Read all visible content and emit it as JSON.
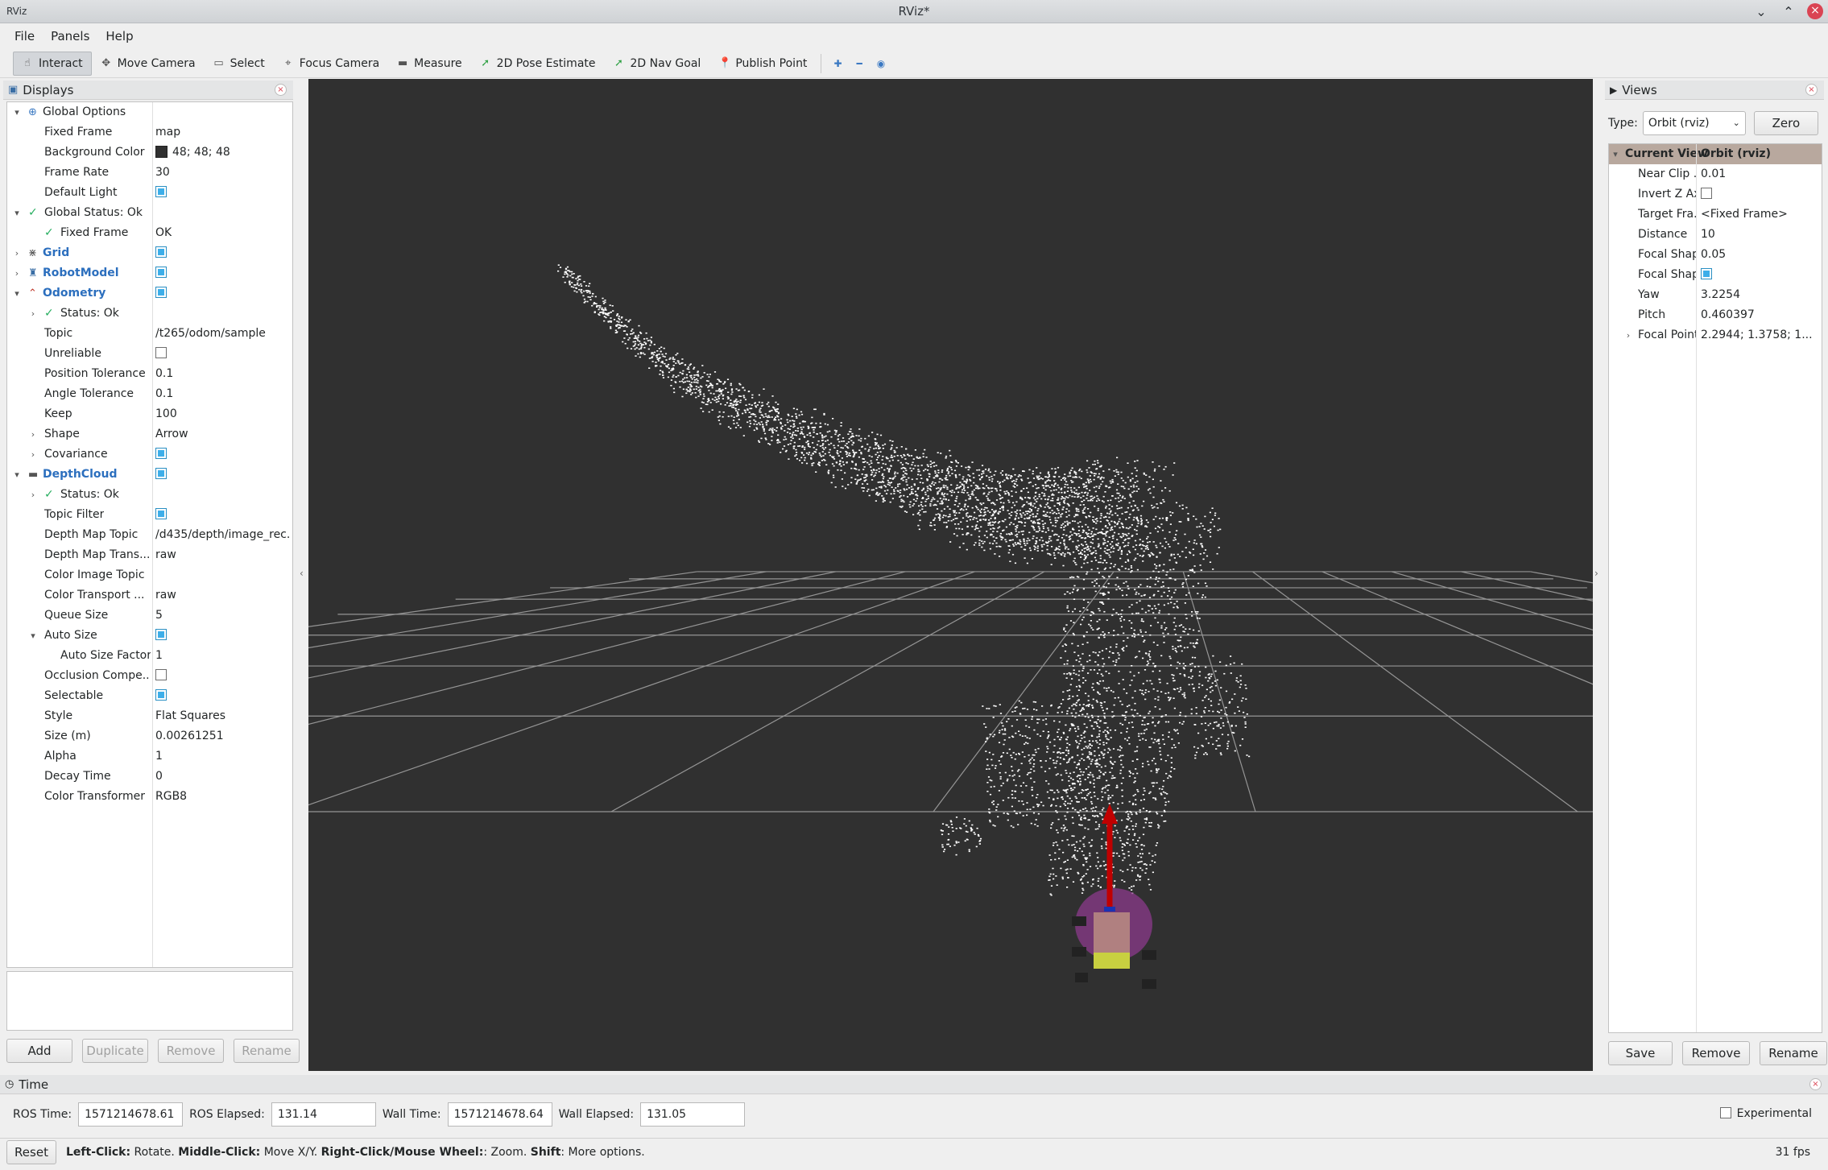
{
  "window": {
    "title": "RViz*",
    "app_icon": "RViz"
  },
  "menu": [
    "File",
    "Panels",
    "Help"
  ],
  "toolbar": {
    "tools": [
      {
        "label": "Interact",
        "icon": "hand-icon",
        "glyph": "☝",
        "active": true
      },
      {
        "label": "Move Camera",
        "icon": "move-icon",
        "glyph": "✥"
      },
      {
        "label": "Select",
        "icon": "select-icon",
        "glyph": "▭"
      },
      {
        "label": "Focus Camera",
        "icon": "crosshair-icon",
        "glyph": "⌖"
      },
      {
        "label": "Measure",
        "icon": "ruler-icon",
        "glyph": "▬"
      },
      {
        "label": "2D Pose Estimate",
        "icon": "green-arrow-icon",
        "glyph": "➚"
      },
      {
        "label": "2D Nav Goal",
        "icon": "green-arrow-icon",
        "glyph": "➚"
      },
      {
        "label": "Publish Point",
        "icon": "pin-icon",
        "glyph": "📍"
      }
    ],
    "extra_icons": [
      "plus-icon",
      "minus-icon",
      "eye-icon"
    ]
  },
  "displays": {
    "title": "Displays",
    "rows": [
      {
        "indent": 0,
        "arrow": "▾",
        "label": "Global Options",
        "icon": "globe-icon",
        "value": ""
      },
      {
        "indent": 1,
        "label": "Fixed Frame",
        "value": "map"
      },
      {
        "indent": 1,
        "label": "Background Color",
        "value": "48; 48; 48",
        "swatch": "#303030"
      },
      {
        "indent": 1,
        "label": "Frame Rate",
        "value": "30"
      },
      {
        "indent": 1,
        "label": "Default Light",
        "check": true
      },
      {
        "indent": 0,
        "arrow": "▾",
        "label": "Global Status: Ok",
        "ok": true,
        "value": ""
      },
      {
        "indent": 1,
        "label": "Fixed Frame",
        "ok": true,
        "value": "OK"
      },
      {
        "indent": 0,
        "arrow": "›",
        "label": "Grid",
        "blue": true,
        "icon": "grid-icon",
        "check": true
      },
      {
        "indent": 0,
        "arrow": "›",
        "label": "RobotModel",
        "blue": true,
        "icon": "robot-icon",
        "check": true
      },
      {
        "indent": 0,
        "arrow": "▾",
        "label": "Odometry",
        "blue": true,
        "icon": "odometry-icon",
        "check": true
      },
      {
        "indent": 1,
        "arrow": "›",
        "label": "Status: Ok",
        "ok": true,
        "value": ""
      },
      {
        "indent": 1,
        "label": "Topic",
        "value": "/t265/odom/sample"
      },
      {
        "indent": 1,
        "label": "Unreliable",
        "check": false
      },
      {
        "indent": 1,
        "label": "Position Tolerance",
        "value": "0.1"
      },
      {
        "indent": 1,
        "label": "Angle Tolerance",
        "value": "0.1"
      },
      {
        "indent": 1,
        "label": "Keep",
        "value": "100"
      },
      {
        "indent": 1,
        "arrow": "›",
        "label": "Shape",
        "value": "Arrow"
      },
      {
        "indent": 1,
        "arrow": "›",
        "label": "Covariance",
        "check": true
      },
      {
        "indent": 0,
        "arrow": "▾",
        "label": "DepthCloud",
        "blue": true,
        "icon": "depthcloud-icon",
        "check": true
      },
      {
        "indent": 1,
        "arrow": "›",
        "label": "Status: Ok",
        "ok": true,
        "value": ""
      },
      {
        "indent": 1,
        "label": "Topic Filter",
        "check": true
      },
      {
        "indent": 1,
        "label": "Depth Map Topic",
        "value": "/d435/depth/image_rec..."
      },
      {
        "indent": 1,
        "label": "Depth Map Trans...",
        "value": "raw"
      },
      {
        "indent": 1,
        "label": "Color Image Topic",
        "value": ""
      },
      {
        "indent": 1,
        "label": "Color Transport ...",
        "value": "raw"
      },
      {
        "indent": 1,
        "label": "Queue Size",
        "value": "5"
      },
      {
        "indent": 1,
        "arrow": "▾",
        "label": "Auto Size",
        "check": true
      },
      {
        "indent": 2,
        "label": "Auto Size Factor",
        "value": "1"
      },
      {
        "indent": 1,
        "label": "Occlusion Compe...",
        "check": false
      },
      {
        "indent": 1,
        "label": "Selectable",
        "check": true
      },
      {
        "indent": 1,
        "label": "Style",
        "value": "Flat Squares"
      },
      {
        "indent": 1,
        "label": "Size (m)",
        "value": "0.00261251"
      },
      {
        "indent": 1,
        "label": "Alpha",
        "value": "1"
      },
      {
        "indent": 1,
        "label": "Decay Time",
        "value": "0"
      },
      {
        "indent": 1,
        "label": "Color Transformer",
        "value": "RGB8"
      }
    ],
    "buttons": {
      "add": "Add",
      "duplicate": "Duplicate",
      "remove": "Remove",
      "rename": "Rename"
    }
  },
  "views": {
    "title": "Views",
    "type_label": "Type:",
    "type_value": "Orbit (rviz)",
    "zero_label": "Zero",
    "header": {
      "label": "Current View",
      "value": "Orbit (rviz)"
    },
    "rows": [
      {
        "label": "Near Clip ...",
        "value": "0.01"
      },
      {
        "label": "Invert Z Axis",
        "check": false
      },
      {
        "label": "Target Fra...",
        "value": "<Fixed Frame>"
      },
      {
        "label": "Distance",
        "value": "10"
      },
      {
        "label": "Focal Shap...",
        "value": "0.05"
      },
      {
        "label": "Focal Shap...",
        "check": true
      },
      {
        "label": "Yaw",
        "value": "3.2254"
      },
      {
        "label": "Pitch",
        "value": "0.460397"
      },
      {
        "label": "Focal Point",
        "value": "2.2944; 1.3758; 1...",
        "arrow": "›"
      }
    ],
    "buttons": {
      "save": "Save",
      "remove": "Remove",
      "rename": "Rename"
    }
  },
  "time": {
    "title": "Time",
    "ros_time_label": "ROS Time:",
    "ros_time": "1571214678.61",
    "ros_elapsed_label": "ROS Elapsed:",
    "ros_elapsed": "131.14",
    "wall_time_label": "Wall Time:",
    "wall_time": "1571214678.64",
    "wall_elapsed_label": "Wall Elapsed:",
    "wall_elapsed": "131.05",
    "experimental_label": "Experimental"
  },
  "status": {
    "reset_label": "Reset",
    "left_click": "Left-Click:",
    "left_click_desc": " Rotate. ",
    "middle_click": "Middle-Click:",
    "middle_click_desc": " Move X/Y. ",
    "right_click": "Right-Click/Mouse Wheel:",
    "right_click_desc": ": Zoom. ",
    "shift": "Shift",
    "shift_desc": ": More options.",
    "fps": "31 fps"
  },
  "colors": {
    "background": "#303030",
    "grid": "#a0a0a0",
    "cloud": "#ffffff",
    "odom_arrow": "#cc0000",
    "accent": "#3daee9"
  }
}
